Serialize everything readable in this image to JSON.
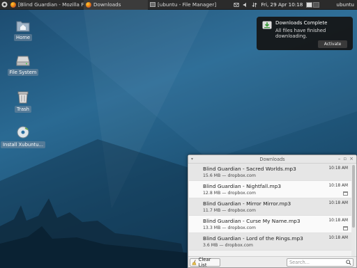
{
  "panel": {
    "tasks": [
      {
        "label": "[Blind Guardian - Mozilla Fir...",
        "icon": "firefox-icon"
      },
      {
        "label": "Downloads",
        "icon": "firefox-icon"
      },
      {
        "label": "[ubuntu - File Manager]",
        "icon": "file-manager-icon"
      }
    ],
    "clock": "Fri, 29 Apr  10:18",
    "user": "ubuntu"
  },
  "desktop_icons": [
    {
      "label": "Home",
      "icon": "home-folder-icon"
    },
    {
      "label": "File System",
      "icon": "drive-icon"
    },
    {
      "label": "Trash",
      "icon": "trash-icon"
    },
    {
      "label": "Install Xubuntu...",
      "icon": "install-disc-icon"
    }
  ],
  "notification": {
    "title": "Downloads Complete",
    "body": "All files have finished downloading.",
    "action": "Activate"
  },
  "downloads": {
    "title": "Downloads",
    "items": [
      {
        "name": "Blind Guardian - Sacred Worlds.mp3",
        "meta": "15.6 MB — dropbox.com",
        "time": "10:18 AM"
      },
      {
        "name": "Blind Guardian - Nightfall.mp3",
        "meta": "12.8 MB — dropbox.com",
        "time": "10:18 AM"
      },
      {
        "name": "Blind Guardian - Mirror Mirror.mp3",
        "meta": "11.7 MB — dropbox.com",
        "time": "10:18 AM"
      },
      {
        "name": "Blind Guardian - Curse My Name.mp3",
        "meta": "13.3 MB — dropbox.com",
        "time": "10:18 AM"
      },
      {
        "name": "Blind Guardian - Lord of the Rings.mp3",
        "meta": "3.6 MB — dropbox.com",
        "time": "10:18 AM"
      }
    ],
    "clear_label": "Clear List",
    "search_placeholder": "Search..."
  }
}
